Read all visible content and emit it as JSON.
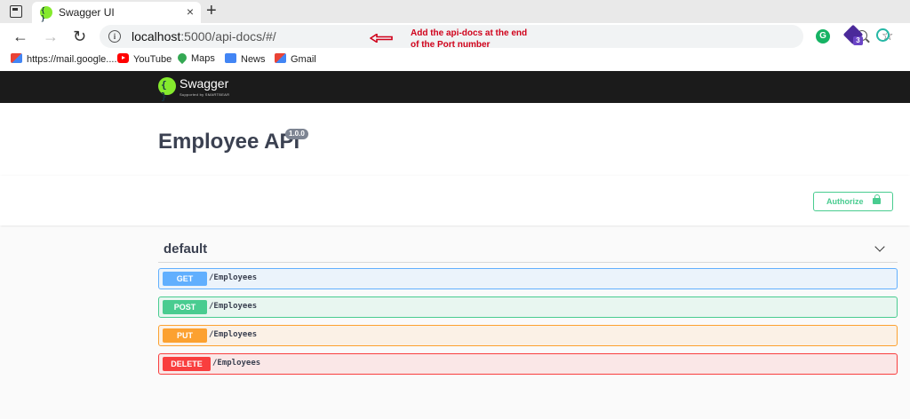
{
  "browser": {
    "tab_title": "Swagger UI",
    "tab_close": "×",
    "new_tab": "+",
    "url_host": "localhost",
    "url_rest": ":5000/api-docs/#/",
    "annotation_line1": "Add the api-docs at the end",
    "annotation_line2": "of the Port number",
    "annotation_color": "#d0021b",
    "nav_back": "←",
    "nav_forward": "→",
    "nav_reload": "↻",
    "favorite_glyph": "☆",
    "ext_g_letter": "G",
    "ext_badge_count": "3",
    "bookmarks": [
      {
        "label": "https://mail.google....",
        "icon": "gmail-icon"
      },
      {
        "label": "YouTube",
        "icon": "youtube-icon"
      },
      {
        "label": "Maps",
        "icon": "maps-icon"
      },
      {
        "label": "News",
        "icon": "news-icon"
      },
      {
        "label": "Gmail",
        "icon": "gmail-icon"
      }
    ]
  },
  "swagger": {
    "logo_text": "Swagger",
    "logo_sub": "Supported by SMARTBEAR",
    "api_title": "Employee API",
    "version": "1.0.0",
    "authorize_label": "Authorize",
    "tag_name": "default",
    "operations": [
      {
        "method": "GET",
        "path": "/Employees",
        "color": "#61affe"
      },
      {
        "method": "POST",
        "path": "/Employees",
        "color": "#49cc90"
      },
      {
        "method": "PUT",
        "path": "/Employees",
        "color": "#fca130"
      },
      {
        "method": "DELETE",
        "path": "/Employees",
        "color": "#f93e3e"
      }
    ]
  }
}
